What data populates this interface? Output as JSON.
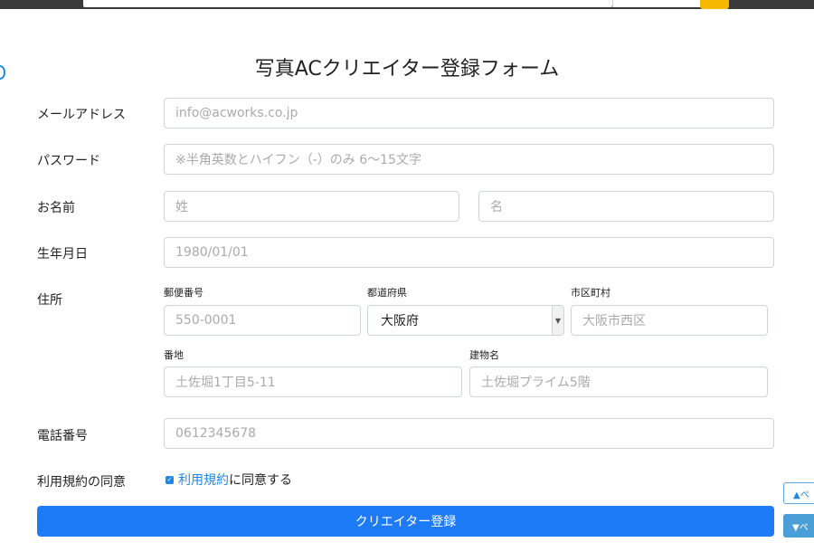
{
  "form": {
    "title": "写真ACクリエイター登録フォーム",
    "email": {
      "label": "メールアドレス",
      "placeholder": "info@acworks.co.jp"
    },
    "password": {
      "label": "パスワード",
      "placeholder": "※半角英数とハイフン（-）のみ 6〜15文字"
    },
    "name": {
      "label": "お名前",
      "last_placeholder": "姓",
      "first_placeholder": "名"
    },
    "birthday": {
      "label": "生年月日",
      "placeholder": "1980/01/01"
    },
    "address": {
      "label": "住所",
      "postal_label": "郵便番号",
      "postal_placeholder": "550-0001",
      "prefecture_label": "都道府県",
      "prefecture_value": "大阪府",
      "city_label": "市区町村",
      "city_placeholder": "大阪市西区",
      "street_label": "番地",
      "street_placeholder": "土佐堀1丁目5-11",
      "building_label": "建物名",
      "building_placeholder": "土佐堀プライム5階"
    },
    "phone": {
      "label": "電話番号",
      "placeholder": "0612345678"
    },
    "terms": {
      "label": "利用規約の同意",
      "link_text": "利用規約",
      "suffix": "に同意する",
      "checked": true
    },
    "submit_label": "クリエイター登録"
  },
  "page_nav": {
    "up_label": "▲ペ",
    "down_label": "▼ペ"
  },
  "colors": {
    "primary": "#1e7bf7",
    "accent_yellow": "#f6b900",
    "header_bg": "#3a3a3a"
  }
}
